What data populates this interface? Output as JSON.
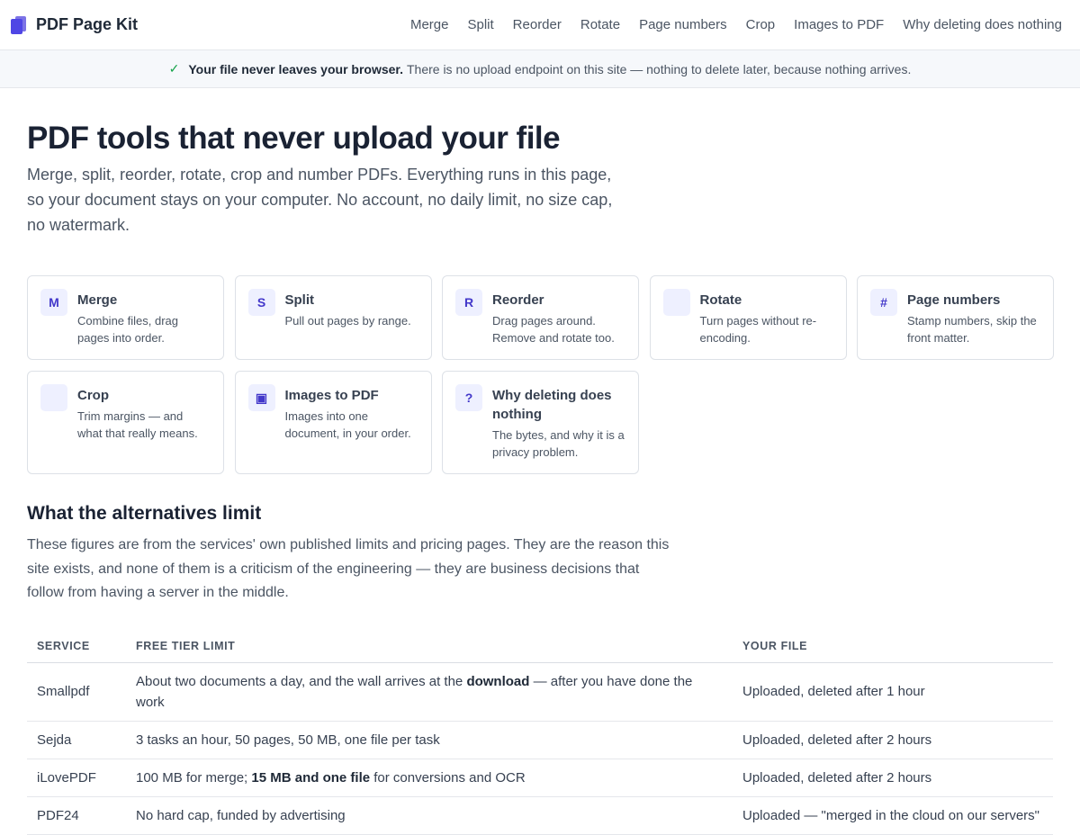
{
  "brand": {
    "name": "PDF Page Kit"
  },
  "nav": [
    "Merge",
    "Split",
    "Reorder",
    "Rotate",
    "Page numbers",
    "Crop",
    "Images to PDF",
    "Why deleting does nothing"
  ],
  "banner": {
    "strong": "Your file never leaves your browser.",
    "text": "There is no upload endpoint on this site — nothing to delete later, because nothing arrives."
  },
  "hero": {
    "title": "PDF tools that never upload your file",
    "lede": "Merge, split, reorder, rotate, crop and number PDFs. Everything runs in this page, so your document stays on your computer. No account, no daily limit, no size cap, no watermark."
  },
  "tools": [
    {
      "badge": "M",
      "title": "Merge",
      "desc": "Combine files, drag pages into order."
    },
    {
      "badge": "S",
      "title": "Split",
      "desc": "Pull out pages by range."
    },
    {
      "badge": "R",
      "title": "Reorder",
      "desc": "Drag pages around. Remove and rotate too."
    },
    {
      "badge": "",
      "title": "Rotate",
      "desc": "Turn pages without re-encoding."
    },
    {
      "badge": "#",
      "title": "Page numbers",
      "desc": "Stamp numbers, skip the front matter."
    },
    {
      "badge": "",
      "title": "Crop",
      "desc": "Trim margins — and what that really means."
    },
    {
      "badge": "▣",
      "title": "Images to PDF",
      "desc": "Images into one document, in your order."
    },
    {
      "badge": "?",
      "title": "Why deleting does nothing",
      "desc": "The bytes, and why it is a privacy problem."
    }
  ],
  "alternatives": {
    "title": "What the alternatives limit",
    "paragraph": "These figures are from the services' own published limits and pricing pages. They are the reason this site exists, and none of them is a criticism of the engineering — they are business decisions that follow from having a server in the middle.",
    "headers": [
      "SERVICE",
      "FREE TIER LIMIT",
      "YOUR FILE"
    ],
    "rows": [
      {
        "service": "Smallpdf",
        "limit": [
          "About two documents a day, and the wall arrives at the ",
          "download",
          " — after you have done the work"
        ],
        "file": "Uploaded, deleted after 1 hour"
      },
      {
        "service": "Sejda",
        "limit": [
          "3 tasks an hour, 50 pages, 50 MB, one file per task",
          "",
          ""
        ],
        "file": "Uploaded, deleted after 2 hours"
      },
      {
        "service": "iLovePDF",
        "limit": [
          "100 MB for merge; ",
          "15 MB and one file",
          " for conversions and OCR"
        ],
        "file": "Uploaded, deleted after 2 hours"
      },
      {
        "service": "PDF24",
        "limit": [
          "No hard cap, funded by advertising",
          "",
          ""
        ],
        "file": "Uploaded — \"merged in the cloud on our servers\""
      }
    ]
  }
}
